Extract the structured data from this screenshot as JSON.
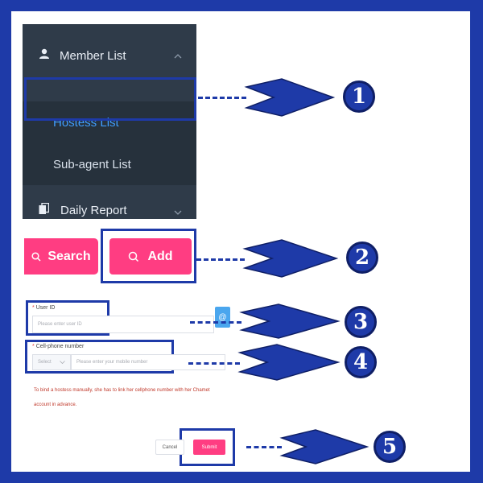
{
  "sidebar": {
    "member_list": {
      "label": "Member List",
      "icon": "user-icon",
      "chevron": "chevron-up-icon"
    },
    "hostess_list": {
      "label": "Hostess List",
      "color": "#409eff"
    },
    "subagent_list": {
      "label": "Sub-agent List"
    },
    "daily_report": {
      "label": "Daily Report",
      "icon": "copy-icon",
      "chevron": "chevron-down-icon"
    }
  },
  "buttons": {
    "search": {
      "label": "Search",
      "icon": "search-icon"
    },
    "add": {
      "label": "Add",
      "icon": "search-icon"
    }
  },
  "form": {
    "user_id": {
      "label": "User ID",
      "placeholder": "Please enter user ID"
    },
    "cell_phone": {
      "label": "Cell-phone number",
      "select_value": "Select",
      "placeholder": "Please enter your mobile number"
    },
    "note_line1": "To bind a hostess manually, she has to link her cellphone number with her Chamet",
    "note_line2": "account in advance.",
    "cancel_label": "Cancel",
    "submit_label": "Submit"
  },
  "callouts": [
    "1",
    "2",
    "3",
    "4",
    "5"
  ],
  "colors": {
    "accent_blue": "#1e3aa8",
    "brand_pink": "#ff3d82",
    "sidebar_bg": "#2f3b49"
  }
}
